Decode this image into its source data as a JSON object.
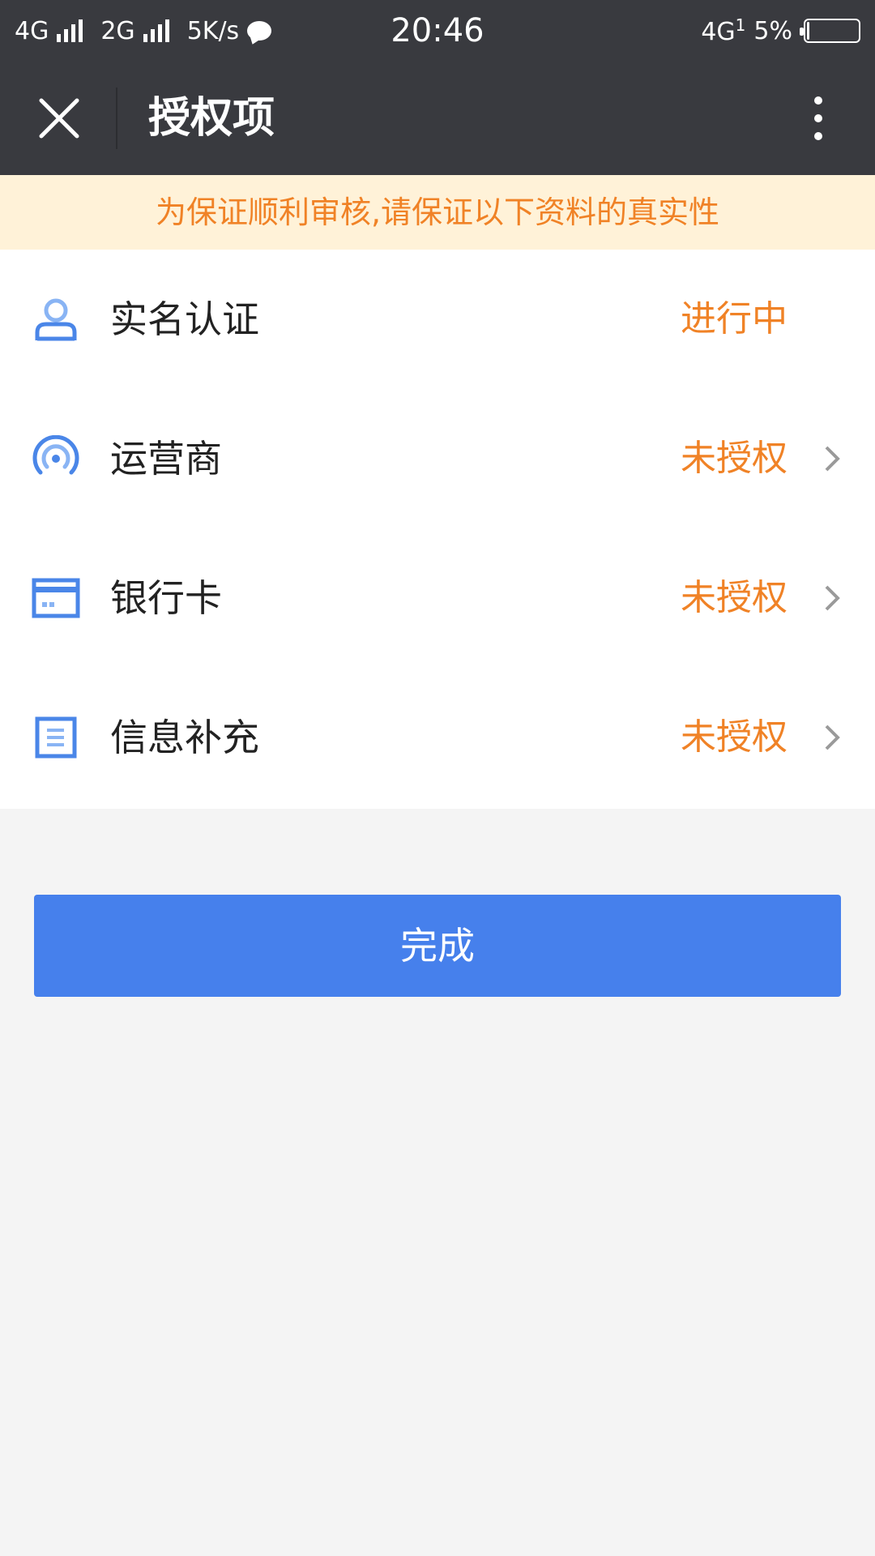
{
  "status_bar": {
    "net1": "4G",
    "net2": "2G",
    "speed": "5K/s",
    "time": "20:46",
    "net_right": "4G",
    "sim_index": "1",
    "battery": "5%",
    "battery_level": 0.05
  },
  "header": {
    "title": "授权项"
  },
  "notice": "为保证顺利审核,请保证以下资料的真实性",
  "items": [
    {
      "label": "实名认证",
      "status": "进行中",
      "icon": "user-icon",
      "has_chevron": false
    },
    {
      "label": "运营商",
      "status": "未授权",
      "icon": "signal-tower-icon",
      "has_chevron": true
    },
    {
      "label": "银行卡",
      "status": "未授权",
      "icon": "bank-card-icon",
      "has_chevron": true
    },
    {
      "label": "信息补充",
      "status": "未授权",
      "icon": "document-icon",
      "has_chevron": true
    }
  ],
  "done_button": "完成",
  "colors": {
    "bar": "#393a3f",
    "accent_orange": "#f08226",
    "notice_bg": "#fff2d8",
    "primary_blue": "#4680ec",
    "icon_blue": "#4a86e8"
  }
}
